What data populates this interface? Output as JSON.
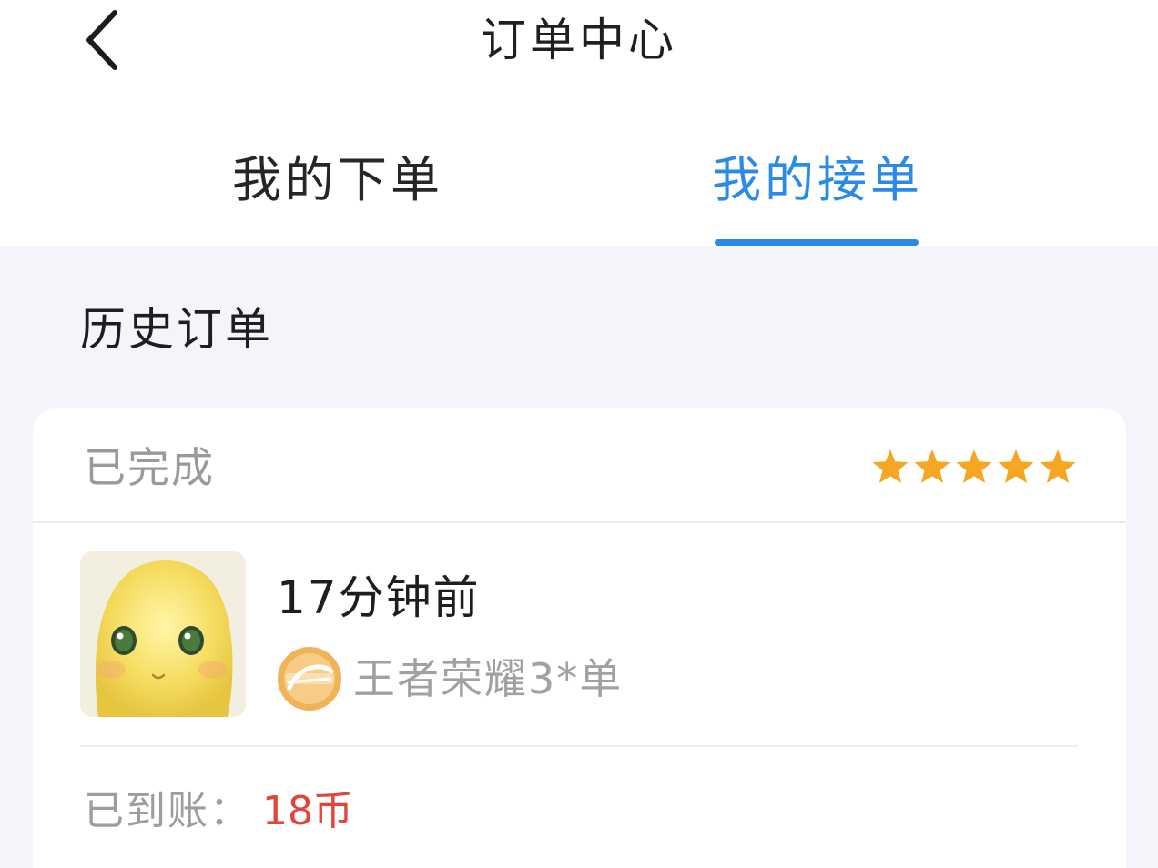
{
  "header": {
    "title": "订单中心",
    "back_icon": "chevron-left-icon"
  },
  "tabs": [
    {
      "label": "我的下单",
      "active": false
    },
    {
      "label": "我的接单",
      "active": true
    }
  ],
  "colors": {
    "accent": "#2a8ae6",
    "star": "#f5a623",
    "amount": "#e2453c",
    "background": "#f4f5fa"
  },
  "section": {
    "title": "历史订单"
  },
  "order": {
    "status": "已完成",
    "rating": 5,
    "rating_max": 5,
    "time": "17分钟前",
    "game_icon": "honor-of-kings-icon",
    "game_label": "王者荣耀3*单",
    "settle_label": "已到账：",
    "settle_amount": "18币"
  }
}
